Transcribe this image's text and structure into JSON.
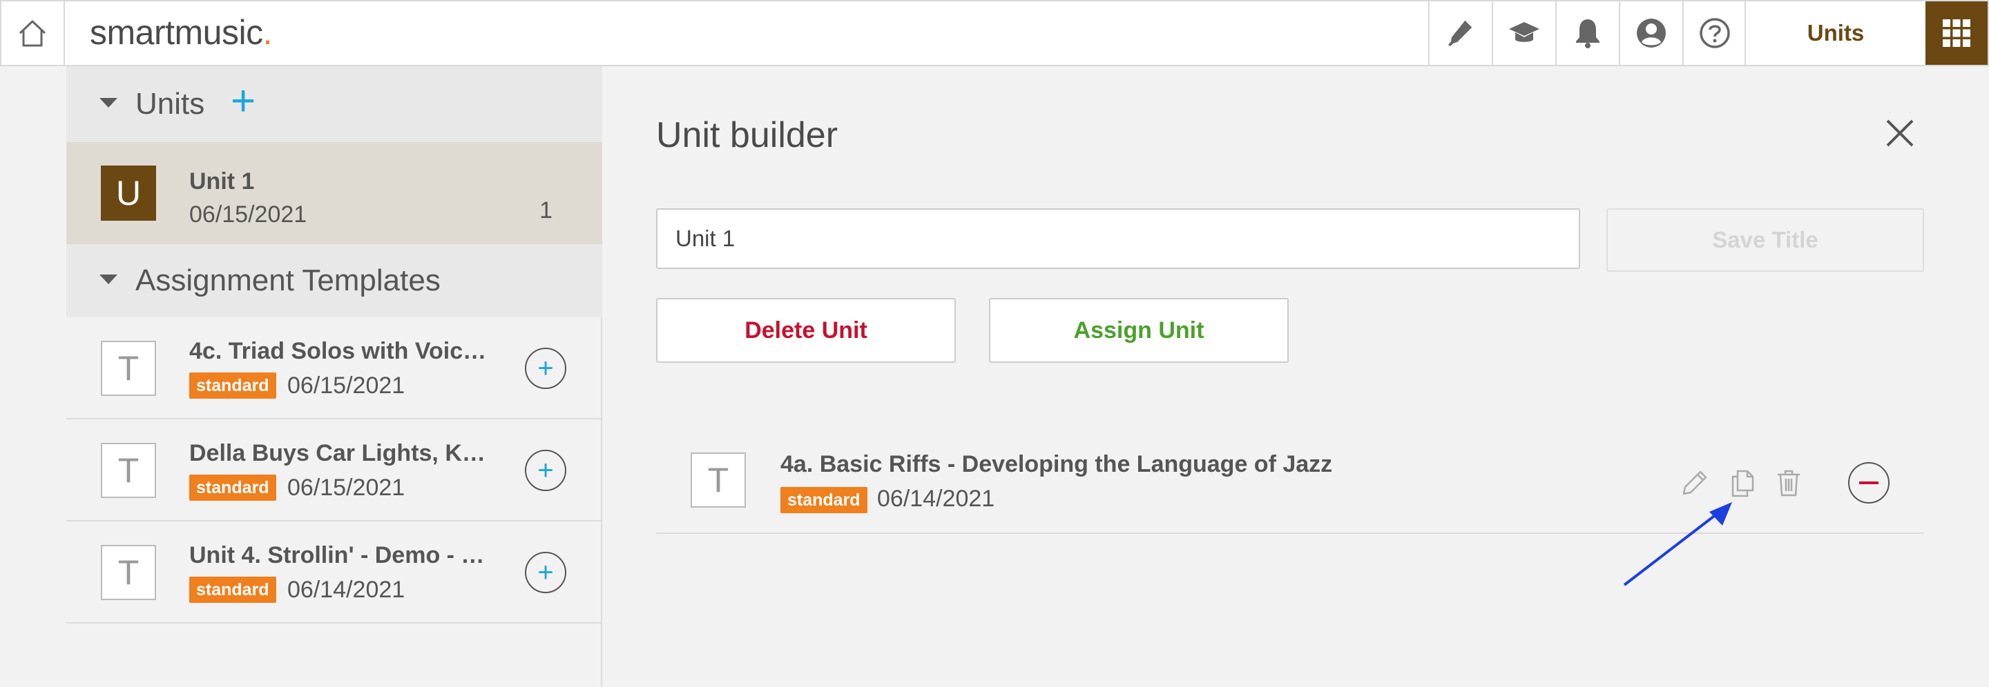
{
  "app": {
    "logo": "smartmusic",
    "logo_dot": "."
  },
  "topnav": {
    "tools": [
      "tuner-icon",
      "graduation-cap-icon",
      "bell-icon",
      "account-icon",
      "help-icon"
    ],
    "units_label": "Units",
    "apps_icon": "grid-icon"
  },
  "sidebar": {
    "units_header": "Units",
    "units": [
      {
        "avatar": "U",
        "title": "Unit 1",
        "date": "06/15/2021",
        "count": "1"
      }
    ],
    "templates_header": "Assignment Templates",
    "templates": [
      {
        "avatar": "T",
        "title": "4c. Triad Solos with Voic…",
        "badge": "standard",
        "date": "06/15/2021"
      },
      {
        "avatar": "T",
        "title": "Della Buys Car Lights, K…",
        "badge": "standard",
        "date": "06/15/2021"
      },
      {
        "avatar": "T",
        "title": "Unit 4. Strollin' - Demo - …",
        "badge": "standard",
        "date": "06/14/2021"
      }
    ]
  },
  "builder": {
    "title": "Unit builder",
    "name_value": "Unit 1",
    "save_title": "Save Title",
    "delete_unit": "Delete Unit",
    "assign_unit": "Assign Unit",
    "items": [
      {
        "avatar": "T",
        "title": "4a. Basic Riffs - Developing the Language of Jazz",
        "badge": "standard",
        "date": "06/14/2021"
      }
    ]
  },
  "colors": {
    "brand": "#6b4712",
    "accent": "#1aa7d8",
    "badge": "#f07f1e",
    "danger": "#c8102e",
    "success": "#4ca02c"
  }
}
